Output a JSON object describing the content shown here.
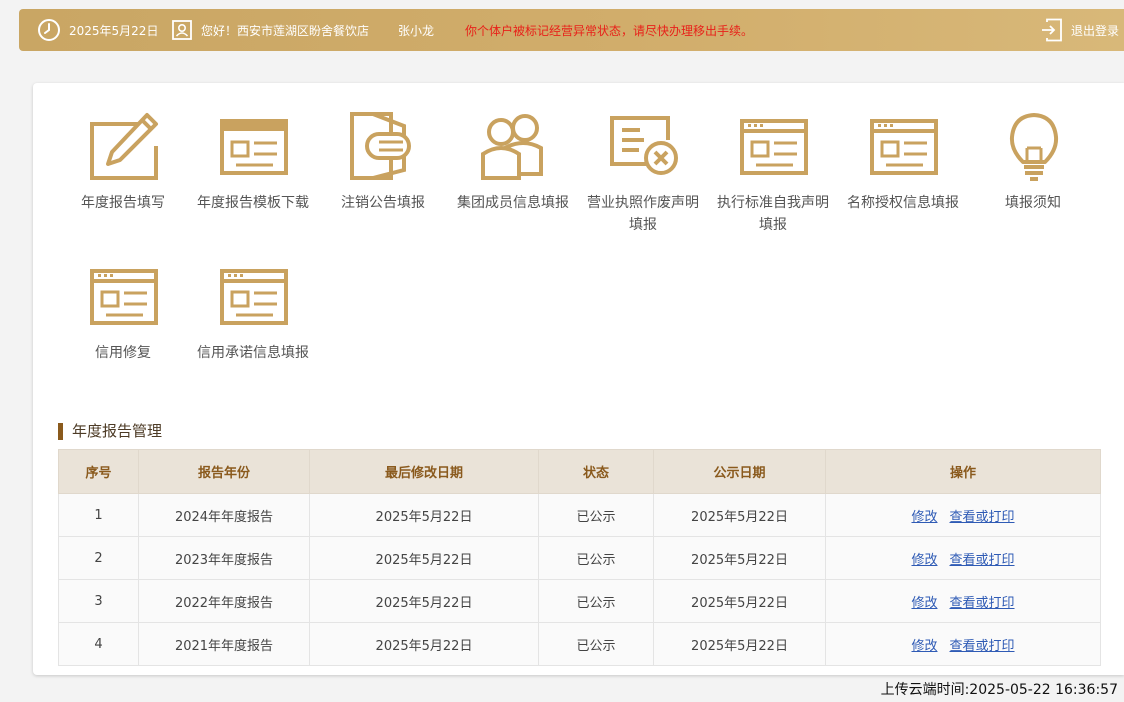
{
  "header": {
    "date": "2025年5月22日",
    "greeting": "您好！西安市莲湖区盼舍餐饮店",
    "user_name": "张小龙",
    "warning": "你个体户被标记经营异常状态，请尽快办理移出手续。",
    "logout_label": "退出登录"
  },
  "menu": {
    "items": [
      {
        "label": "年度报告填写",
        "icon": "edit-icon"
      },
      {
        "label": "年度报告模板下载",
        "icon": "form-template-icon"
      },
      {
        "label": "注销公告填报",
        "icon": "document-cancel-icon"
      },
      {
        "label": "集团成员信息填报",
        "icon": "group-members-icon"
      },
      {
        "label": "营业执照作废声明填报",
        "icon": "license-void-icon"
      },
      {
        "label": "执行标准自我声明填报",
        "icon": "form-template-icon"
      },
      {
        "label": "名称授权信息填报",
        "icon": "form-template-icon"
      },
      {
        "label": "填报须知",
        "icon": "lightbulb-icon"
      },
      {
        "label": "信用修复",
        "icon": "form-template-icon"
      },
      {
        "label": "信用承诺信息填报",
        "icon": "form-template-icon"
      }
    ]
  },
  "reports": {
    "section_title": "年度报告管理",
    "columns": [
      "序号",
      "报告年份",
      "最后修改日期",
      "状态",
      "公示日期",
      "操作"
    ],
    "rows": [
      {
        "no": "1",
        "year": "2024年年度报告",
        "modified": "2025年5月22日",
        "status": "已公示",
        "published": "2025年5月22日"
      },
      {
        "no": "2",
        "year": "2023年年度报告",
        "modified": "2025年5月22日",
        "status": "已公示",
        "published": "2025年5月22日"
      },
      {
        "no": "3",
        "year": "2022年年度报告",
        "modified": "2025年5月22日",
        "status": "已公示",
        "published": "2025年5月22日"
      },
      {
        "no": "4",
        "year": "2021年年度报告",
        "modified": "2025年5月22日",
        "status": "已公示",
        "published": "2025年5月22日"
      }
    ],
    "edit_label": "修改",
    "view_label": "查看或打印"
  },
  "footer": {
    "upload_time": "上传云端时间:2025-05-22 16:36:57"
  },
  "colors": {
    "header_gold": "#d1ad6b",
    "icon_gold": "#c9a25f",
    "warning_red": "#e8211a",
    "link_blue": "#2f5bb5",
    "section_accent": "#8a5a1d"
  }
}
